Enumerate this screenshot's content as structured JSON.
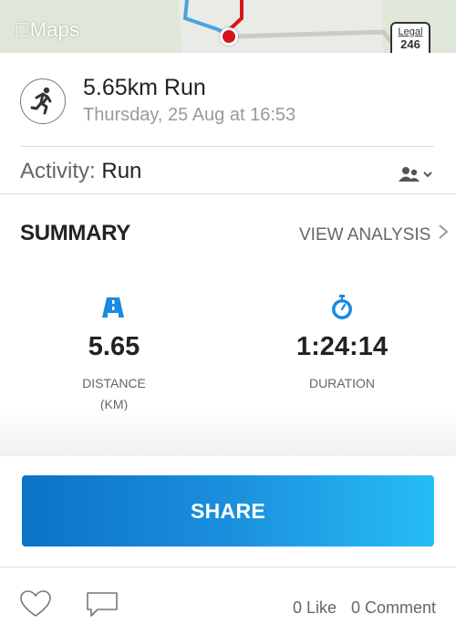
{
  "map": {
    "logo": "Maps",
    "legal": "Legal",
    "road_number": "246"
  },
  "activity": {
    "title": "5.65km Run",
    "datetime": "Thursday, 25 Aug at 16:53",
    "type_label": "Activity:",
    "type_value": "Run"
  },
  "summary": {
    "title": "SUMMARY",
    "view_analysis": "VIEW ANALYSIS",
    "distance": {
      "value": "5.65",
      "label_line1": "DISTANCE",
      "label_line2": "(KM)"
    },
    "duration": {
      "value": "1:24:14",
      "label": "DURATION"
    }
  },
  "share_label": "SHARE",
  "social": {
    "like_count": "0",
    "like_label": "Like",
    "comment_count": "0",
    "comment_label": "Comment"
  },
  "colors": {
    "accent": "#1a8be0",
    "pin": "#d8141b",
    "share_start": "#0b73c7",
    "share_end": "#27bdf6"
  }
}
